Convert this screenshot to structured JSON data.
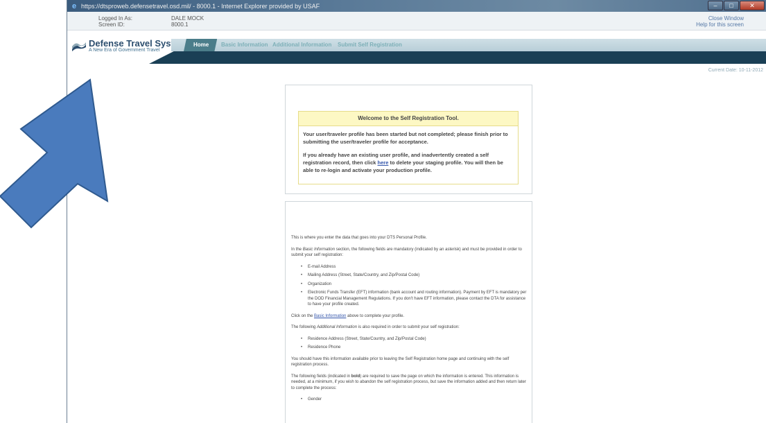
{
  "window": {
    "title": "https://dtsproweb.defensetravel.osd.mil/ - 8000.1 - Internet Explorer provided by USAF"
  },
  "login": {
    "logged_in_label": "Logged In As:",
    "logged_in_value": "DALE MOCK",
    "screen_id_label": "Screen ID:",
    "screen_id_value": "8000.1",
    "close_window": "Close Window",
    "help": "Help for this screen"
  },
  "brand": {
    "name": "Defense Travel System",
    "tagline": "A New Era of Government Travel"
  },
  "nav": {
    "tabs": [
      "Home",
      "Basic Information",
      "Additional Information",
      "Submit Self Registration"
    ]
  },
  "current_date": "Current Date: 10-11-2012",
  "welcome": {
    "title": "Welcome to the Self Registration Tool.",
    "p1": "Your user/traveler profile has been started but not completed; please finish prior to submitting the user/traveler profile for acceptance.",
    "p2_before": "If you already have an existing user profile, and inadvertently created a self registration record, then click ",
    "p2_link": "here",
    "p2_after": " to delete your staging profile. You will then be able to re-login and activate your production profile."
  },
  "info": {
    "p1": "This is where you enter the data that goes into your DTS Personal Profile.",
    "p2_a": "In the ",
    "p2_italic": "Basic Information",
    "p2_b": " section, the following fields are mandatory (indicated by an asterisk) and must be provided in order to submit your self registration:",
    "mandatory": [
      "E-mail Address",
      "Mailing Address (Street, State/Country, and Zip/Postal Code)",
      "Organization",
      "Electronic Funds Transfer (EFT) information (bank account and routing information). Payment by EFT is mandatory per the DOD Financial Management Regulations. If you don't have EFT information, please contact the DTA for assistance to have your profile created."
    ],
    "p3_a": "Click on the ",
    "p3_link": "Basic Information",
    "p3_b": " above to complete your profile.",
    "p4_a": "The following ",
    "p4_italic": "Additional Information",
    "p4_b": " is also required in order to submit your self registration:",
    "additional": [
      "Residence Address (Street, State/Country, and Zip/Postal Code)",
      "Residence Phone"
    ],
    "p5": "You should have this information available prior to leaving the Self Registration home page and continuing with the self registration process.",
    "p6_a": "The following fields (indicated in ",
    "p6_bold": "bold",
    "p6_b": ") are required to save the page on which the information is entered. This information is needed, at a minimum, if you wish to abandon the self registration process, but save the information added and then return later to complete the process:",
    "save_fields": [
      "Gender"
    ]
  },
  "colors": {
    "arrow": "#4a7bbd",
    "nav_dark": "#1a3f55",
    "welcome_bg": "#fdf8c4"
  }
}
